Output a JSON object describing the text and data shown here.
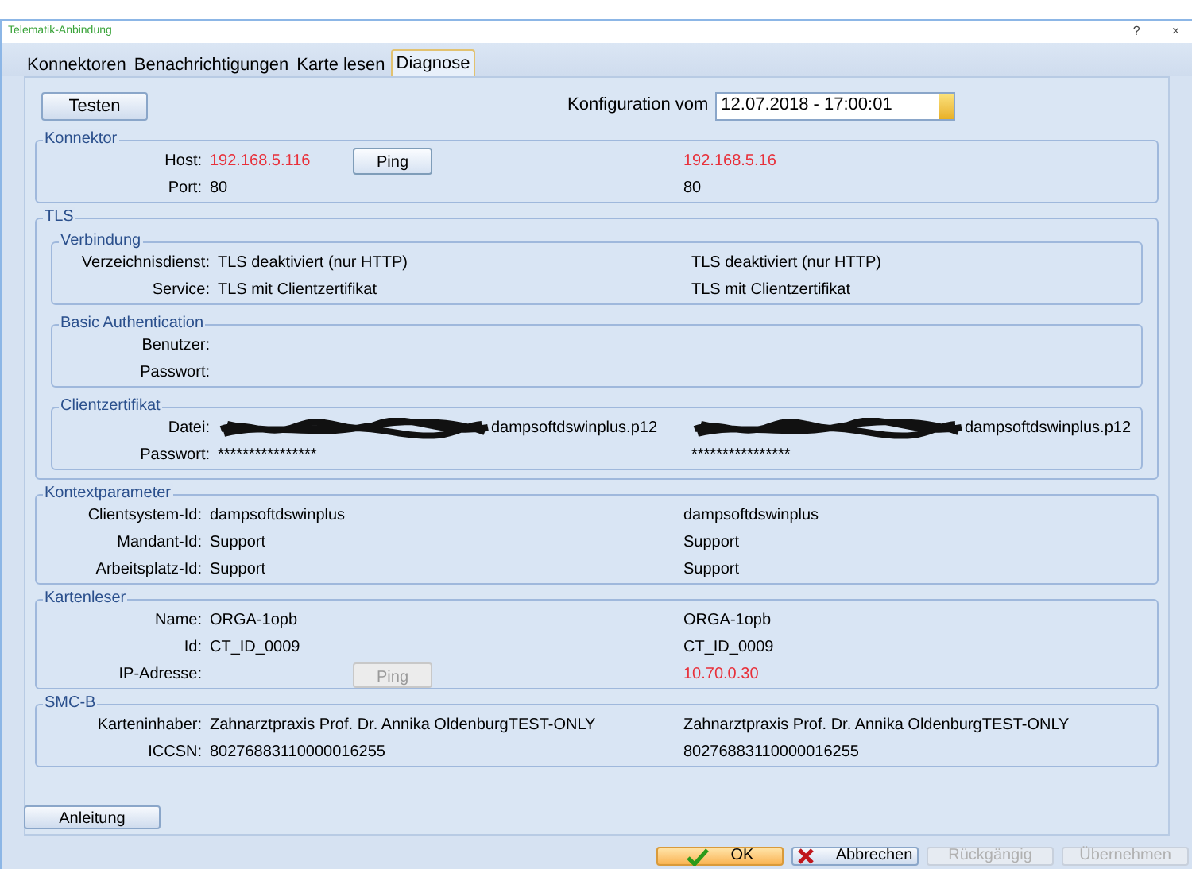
{
  "window": {
    "title": "Telematik-Anbindung",
    "controls": [
      "?",
      "×"
    ]
  },
  "tabs": [
    {
      "label": "Konnektoren",
      "selected": false
    },
    {
      "label": "Benachrichtigungen",
      "selected": false
    },
    {
      "label": "Karte lesen",
      "selected": false
    },
    {
      "label": "Diagnose",
      "selected": true
    }
  ],
  "test_button": "Testen",
  "config": {
    "label": "Konfiguration vom",
    "value": "12.07.2018 - 17:00:01"
  },
  "sections": [
    {
      "title": "Konnektor",
      "rows": [
        {
          "label": "Host:",
          "left": {
            "text": "192.168.5.116",
            "alert": true
          },
          "right": {
            "text": "192.168.5.16",
            "alert": true
          },
          "ping": {
            "label": "Ping",
            "disabled": false
          }
        },
        {
          "label": "Port:",
          "left": {
            "text": "80",
            "alert": false
          },
          "right": {
            "text": "80",
            "alert": false
          }
        }
      ]
    },
    {
      "title": "TLS",
      "groups": [
        {
          "title": "Verbindung",
          "rows": [
            {
              "label": "Verzeichnisdienst:",
              "left": {
                "text": "TLS deaktiviert (nur HTTP)",
                "alert": false
              },
              "right": {
                "text": "TLS deaktiviert (nur HTTP)",
                "alert": false
              }
            },
            {
              "label": "Service:",
              "left": {
                "text": "TLS mit Clientzertifikat",
                "alert": false
              },
              "right": {
                "text": "TLS mit Clientzertifikat",
                "alert": false
              }
            }
          ]
        },
        {
          "title": "Basic Authentication",
          "rows": [
            {
              "label": "Benutzer:"
            },
            {
              "label": "Passwort:"
            }
          ]
        },
        {
          "title": "Clientzertifikat",
          "rows": [
            {
              "label": "Datei:",
              "left": {
                "text": "dampsoftdswinplus.p12",
                "alert": false,
                "redacted": true
              },
              "right": {
                "text": "dampsoftdswinplus.p12",
                "alert": false,
                "redacted": true
              }
            },
            {
              "label": "Passwort:",
              "left": {
                "text": "****************",
                "alert": false
              },
              "right": {
                "text": "****************",
                "alert": false
              }
            }
          ]
        }
      ]
    },
    {
      "title": "Kontextparameter",
      "rows": [
        {
          "label": "Clientsystem-Id:",
          "left": {
            "text": "dampsoftdswinplus",
            "alert": false
          },
          "right": {
            "text": "dampsoftdswinplus",
            "alert": false
          }
        },
        {
          "label": "Mandant-Id:",
          "left": {
            "text": "Support",
            "alert": false
          },
          "right": {
            "text": "Support",
            "alert": false
          }
        },
        {
          "label": "Arbeitsplatz-Id:",
          "left": {
            "text": "Support",
            "alert": false
          },
          "right": {
            "text": "Support",
            "alert": false
          }
        }
      ]
    },
    {
      "title": "Kartenleser",
      "rows": [
        {
          "label": "Name:",
          "left": {
            "text": "ORGA-1opb",
            "alert": false
          },
          "right": {
            "text": "ORGA-1opb",
            "alert": false
          }
        },
        {
          "label": "Id:",
          "left": {
            "text": "CT_ID_0009",
            "alert": false
          },
          "right": {
            "text": "CT_ID_0009",
            "alert": false
          }
        },
        {
          "label": "IP-Adresse:",
          "right": {
            "text": "10.70.0.30",
            "alert": true
          },
          "ping": {
            "label": "Ping",
            "disabled": true
          }
        }
      ]
    },
    {
      "title": "SMC-B",
      "rows": [
        {
          "label": "Karteninhaber:",
          "left": {
            "text": "Zahnarztpraxis Prof. Dr. Annika OldenburgTEST-ONLY",
            "alert": false
          },
          "right": {
            "text": "Zahnarztpraxis Prof. Dr. Annika OldenburgTEST-ONLY",
            "alert": false
          }
        },
        {
          "label": "ICCSN:",
          "left": {
            "text": "80276883110000016255",
            "alert": false
          },
          "right": {
            "text": "80276883110000016255",
            "alert": false
          }
        }
      ]
    }
  ],
  "help_button": "Anleitung",
  "footer_buttons": [
    {
      "label": "OK",
      "kind": "ok",
      "disabled": false
    },
    {
      "label": "Abbrechen",
      "kind": "cancel",
      "disabled": false
    },
    {
      "label": "Rückgängig",
      "kind": "plain",
      "disabled": true
    },
    {
      "label": "Übernehmen",
      "kind": "plain",
      "disabled": true
    }
  ]
}
